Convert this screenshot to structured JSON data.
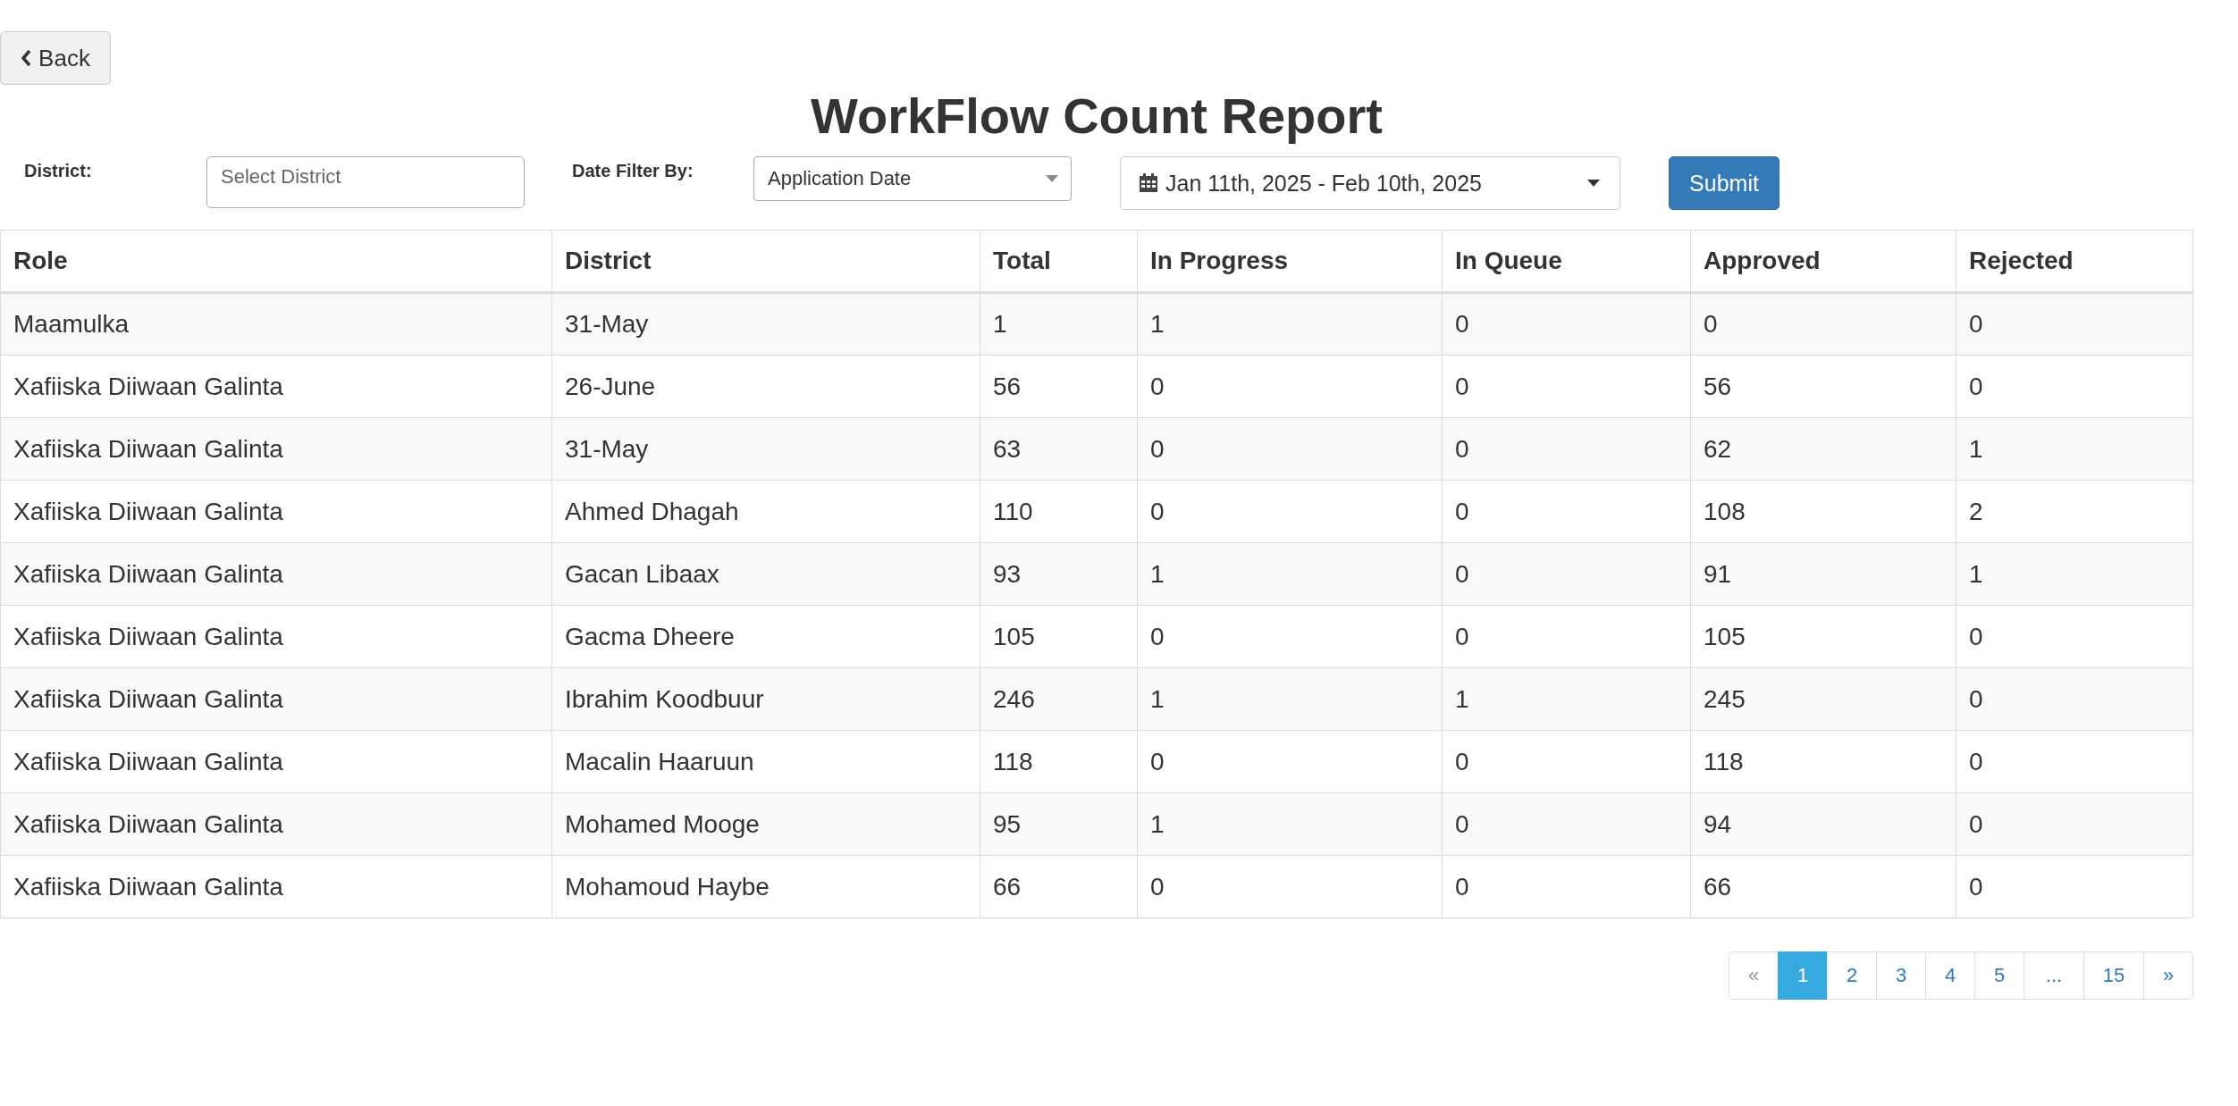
{
  "back_button": {
    "label": "Back"
  },
  "title": "WorkFlow Count Report",
  "filters": {
    "district_label": "District:",
    "district_field": {
      "placeholder": "Select District"
    },
    "date_filter_label": "Date Filter By:",
    "date_filter_select": {
      "value": "Application Date"
    },
    "date_range": {
      "value": "Jan 11th, 2025 - Feb 10th, 2025"
    },
    "submit_button": {
      "label": "Submit"
    }
  },
  "table": {
    "columns": [
      "Role",
      "District",
      "Total",
      "In Progress",
      "In Queue",
      "Approved",
      "Rejected"
    ],
    "rows": [
      [
        "Maamulka",
        "31-May",
        "1",
        "1",
        "0",
        "0",
        "0"
      ],
      [
        "Xafiiska Diiwaan Galinta",
        "26-June",
        "56",
        "0",
        "0",
        "56",
        "0"
      ],
      [
        "Xafiiska Diiwaan Galinta",
        "31-May",
        "63",
        "0",
        "0",
        "62",
        "1"
      ],
      [
        "Xafiiska Diiwaan Galinta",
        "Ahmed Dhagah",
        "110",
        "0",
        "0",
        "108",
        "2"
      ],
      [
        "Xafiiska Diiwaan Galinta",
        "Gacan Libaax",
        "93",
        "1",
        "0",
        "91",
        "1"
      ],
      [
        "Xafiiska Diiwaan Galinta",
        "Gacma Dheere",
        "105",
        "0",
        "0",
        "105",
        "0"
      ],
      [
        "Xafiiska Diiwaan Galinta",
        "Ibrahim Koodbuur",
        "246",
        "1",
        "1",
        "245",
        "0"
      ],
      [
        "Xafiiska Diiwaan Galinta",
        "Macalin Haaruun",
        "118",
        "0",
        "0",
        "118",
        "0"
      ],
      [
        "Xafiiska Diiwaan Galinta",
        "Mohamed Mooge",
        "95",
        "1",
        "0",
        "94",
        "0"
      ],
      [
        "Xafiiska Diiwaan Galinta",
        "Mohamoud Haybe",
        "66",
        "0",
        "0",
        "66",
        "0"
      ]
    ]
  },
  "pagination": [
    {
      "label": "«",
      "selected": false,
      "disabled": true
    },
    {
      "label": "1",
      "selected": true,
      "disabled": false
    },
    {
      "label": "2",
      "selected": false,
      "disabled": false
    },
    {
      "label": "3",
      "selected": false,
      "disabled": false
    },
    {
      "label": "4",
      "selected": false,
      "disabled": false
    },
    {
      "label": "5",
      "selected": false,
      "disabled": false
    },
    {
      "label": "...",
      "selected": false,
      "disabled": false
    },
    {
      "label": "15",
      "selected": false,
      "disabled": false
    },
    {
      "label": "»",
      "selected": false,
      "disabled": false
    }
  ]
}
